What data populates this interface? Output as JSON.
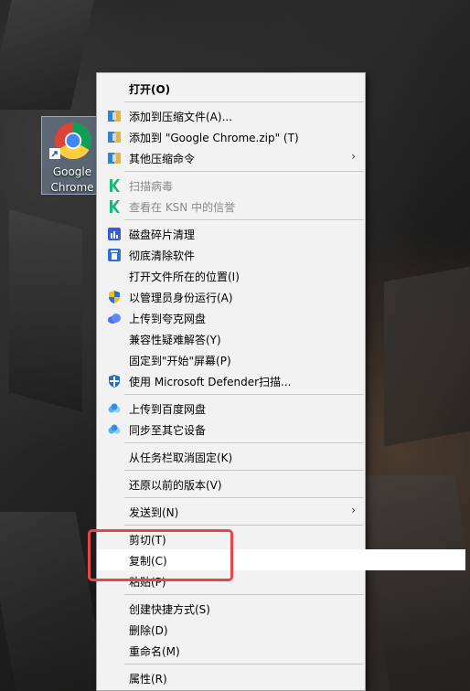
{
  "desktop_icon": {
    "label": "Google\nChrome"
  },
  "menu": {
    "items": [
      {
        "label": "打开(O)",
        "bold": true,
        "icon": "none"
      },
      {
        "label": "添加到压缩文件(A)...",
        "icon": "archive-icon"
      },
      {
        "label": "添加到 \"Google Chrome.zip\" (T)",
        "icon": "archive-icon"
      },
      {
        "label": "其他压缩命令",
        "icon": "archive-icon",
        "submenu": true
      },
      {
        "label": "扫描病毒",
        "icon": "kaspersky-icon",
        "disabled": true
      },
      {
        "label": "查看在 KSN 中的信誉",
        "icon": "kaspersky-icon",
        "disabled": true
      },
      {
        "label": "磁盘碎片清理",
        "icon": "disk-cleanup-icon"
      },
      {
        "label": "彻底清除软件",
        "icon": "uninstall-icon"
      },
      {
        "label": "打开文件所在的位置(I)",
        "icon": "none"
      },
      {
        "label": "以管理员身份运行(A)",
        "icon": "uac-shield-icon"
      },
      {
        "label": "上传到夸克网盘",
        "icon": "quark-cloud-icon"
      },
      {
        "label": "兼容性疑难解答(Y)",
        "icon": "none"
      },
      {
        "label": "固定到\"开始\"屏幕(P)",
        "icon": "none"
      },
      {
        "label": "使用 Microsoft Defender扫描...",
        "icon": "defender-icon"
      },
      {
        "label": "上传到百度网盘",
        "icon": "baidu-cloud-icon"
      },
      {
        "label": "同步至其它设备",
        "icon": "baidu-cloud-icon"
      },
      {
        "label": "从任务栏取消固定(K)",
        "icon": "none"
      },
      {
        "label": "还原以前的版本(V)",
        "icon": "none"
      },
      {
        "label": "发送到(N)",
        "icon": "none",
        "submenu": true
      },
      {
        "label": "剪切(T)",
        "icon": "none"
      },
      {
        "label": "复制(C)",
        "icon": "none",
        "hovered": true
      },
      {
        "label": "粘贴(P)",
        "icon": "none"
      },
      {
        "label": "创建快捷方式(S)",
        "icon": "none"
      },
      {
        "label": "删除(D)",
        "icon": "none"
      },
      {
        "label": "重命名(M)",
        "icon": "none"
      },
      {
        "label": "属性(R)",
        "icon": "none"
      }
    ],
    "submenu_arrow": "›"
  }
}
